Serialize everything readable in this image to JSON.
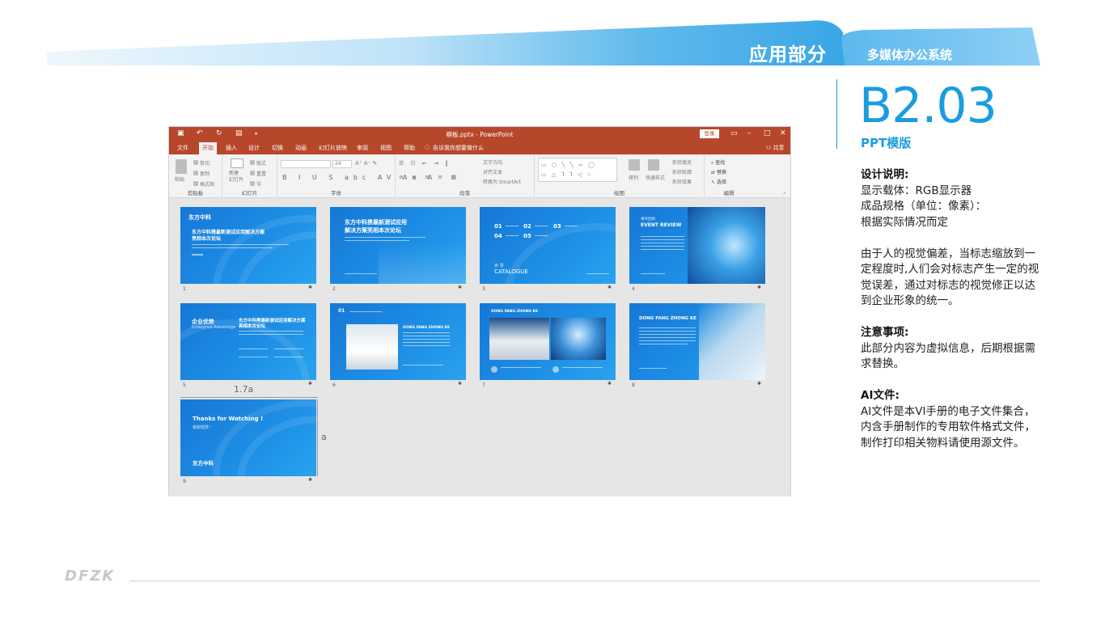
{
  "header": {
    "section_title": "应用部分",
    "section_sub": "多媒体办公系统",
    "accent_color": "#1a9de0"
  },
  "code": {
    "number": "B2.03",
    "label": "PPT模版"
  },
  "notes": {
    "design_heading": "设计说明:",
    "design_lines": [
      "显示载体：RGB显示器",
      "成品规格（单位：像素）：",
      "根据实际情况而定"
    ],
    "para_lines": [
      "由于人的视觉偏差，当标志缩放到一",
      "定程度时,人们会对标志产生一定的视",
      "觉误差，通过对标志的视觉修正以达",
      "到企业形象的统一。"
    ],
    "attention_heading": "注意事项:",
    "attention_lines": [
      "此部分内容为虚拟信息，后期根据需",
      "求替换。"
    ],
    "ai_heading": "AI文件:",
    "ai_lines": [
      "AI文件是本VI手册的电子文件集合，",
      "内含手册制作的专用软件格式文件，",
      "制作打印相关物料请使用源文件。"
    ]
  },
  "footer": {
    "logo": "DFZK"
  },
  "ppt": {
    "window_title": "模板.pptx - PowerPoint",
    "login_label": "登录",
    "share_label": "共享",
    "menu": [
      "文件",
      "开始",
      "插入",
      "设计",
      "切换",
      "动画",
      "幻灯片放映",
      "审阅",
      "视图",
      "帮助"
    ],
    "tell_me": "告诉我你想要做什么",
    "ribbon_groups": [
      "剪贴板",
      "幻灯片",
      "字体",
      "段落",
      "绘图",
      "编辑"
    ],
    "ribbon": {
      "paste": "粘贴",
      "cut": "剪切",
      "copy": "复制",
      "format_painter": "格式刷",
      "new_slide": "新建\n幻灯片",
      "layout": "版式",
      "reset": "重置",
      "section": "节",
      "font_size": "24",
      "text_direction": "文字方向",
      "align_text": "对齐文本",
      "smartart": "转换为 SmartArt",
      "arrange": "排列",
      "quick_styles": "快速样式",
      "shape_fill": "形状填充",
      "shape_outline": "形状轮廓",
      "shape_effects": "形状效果",
      "find": "查找",
      "replace": "替换",
      "select": "选择"
    },
    "slides": [
      {
        "num": "1",
        "title": "东方中科携最新测试应用解决方案",
        "title2": "亮相本次论坛",
        "logo": "东方中科"
      },
      {
        "num": "2",
        "title": "东方中科携最新测试应用",
        "title2": "解决方案亮相本次论坛"
      },
      {
        "num": "3",
        "items": [
          "01",
          "02",
          "03",
          "04",
          "05"
        ],
        "label": "目 录",
        "label2": "CATALOGUE"
      },
      {
        "num": "4",
        "title": "EVENT REVIEW",
        "kicker": "事件回顾"
      },
      {
        "num": "5",
        "title": "企业优势",
        "sub": "Enterprise Advantage",
        "title2": "东方中科携最新测试应用解决方案",
        "title3": "亮相本次论坛"
      },
      {
        "num": "6",
        "kicker": "01",
        "title": "DONG FANG ZHONG KE"
      },
      {
        "num": "7",
        "title": "DONG FANG ZHONG KE"
      },
      {
        "num": "8",
        "title": "DONG FANG ZHONG KE"
      },
      {
        "num": "9",
        "title": "Thanks for Watching !",
        "sub": "谢谢观赏！",
        "logo": "东方中科"
      }
    ],
    "dim_width": "1.7a",
    "dim_height": "a"
  }
}
